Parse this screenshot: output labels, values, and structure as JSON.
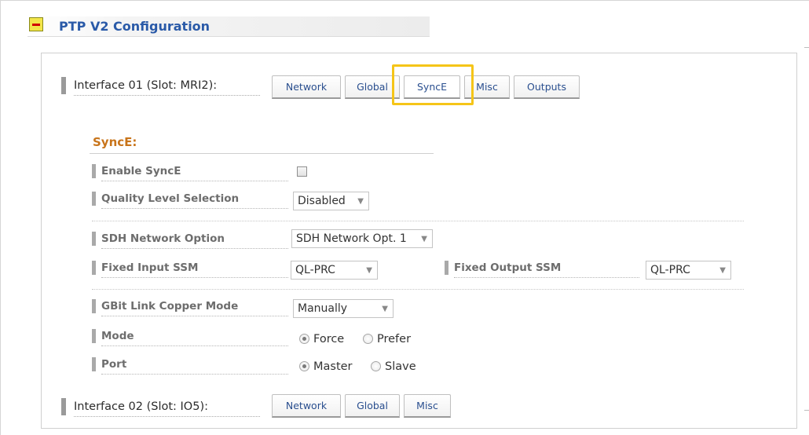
{
  "section": {
    "title": "PTP V2 Configuration"
  },
  "interfaces": [
    {
      "label": "Interface 01 (Slot: MRI2):",
      "tabs": [
        "Network",
        "Global",
        "SyncE",
        "Misc",
        "Outputs"
      ],
      "active_tab": "SyncE"
    },
    {
      "label": "Interface 02 (Slot: IO5):",
      "tabs": [
        "Network",
        "Global",
        "Misc"
      ]
    }
  ],
  "synce": {
    "heading": "SyncE:",
    "enable_label": "Enable SyncE",
    "enable_checked": false,
    "quality_label": "Quality Level Selection",
    "quality_value": "Disabled",
    "sdh_label": "SDH Network Option",
    "sdh_value": "SDH Network Opt. 1",
    "fixed_input_label": "Fixed Input SSM",
    "fixed_input_value": "QL-PRC",
    "fixed_output_label": "Fixed Output SSM",
    "fixed_output_value": "QL-PRC",
    "gbit_label": "GBit Link Copper Mode",
    "gbit_value": "Manually",
    "mode_label": "Mode",
    "mode_options": [
      "Force",
      "Prefer"
    ],
    "mode_selected": "Force",
    "port_label": "Port",
    "port_options": [
      "Master",
      "Slave"
    ],
    "port_selected": "Master"
  },
  "icons": {
    "collapse": "collapse-minus-icon",
    "dropdown": "chevron-down-icon"
  },
  "colors": {
    "highlight": "#f5c518",
    "title": "#2a5aa8",
    "subheading": "#c8741a"
  }
}
